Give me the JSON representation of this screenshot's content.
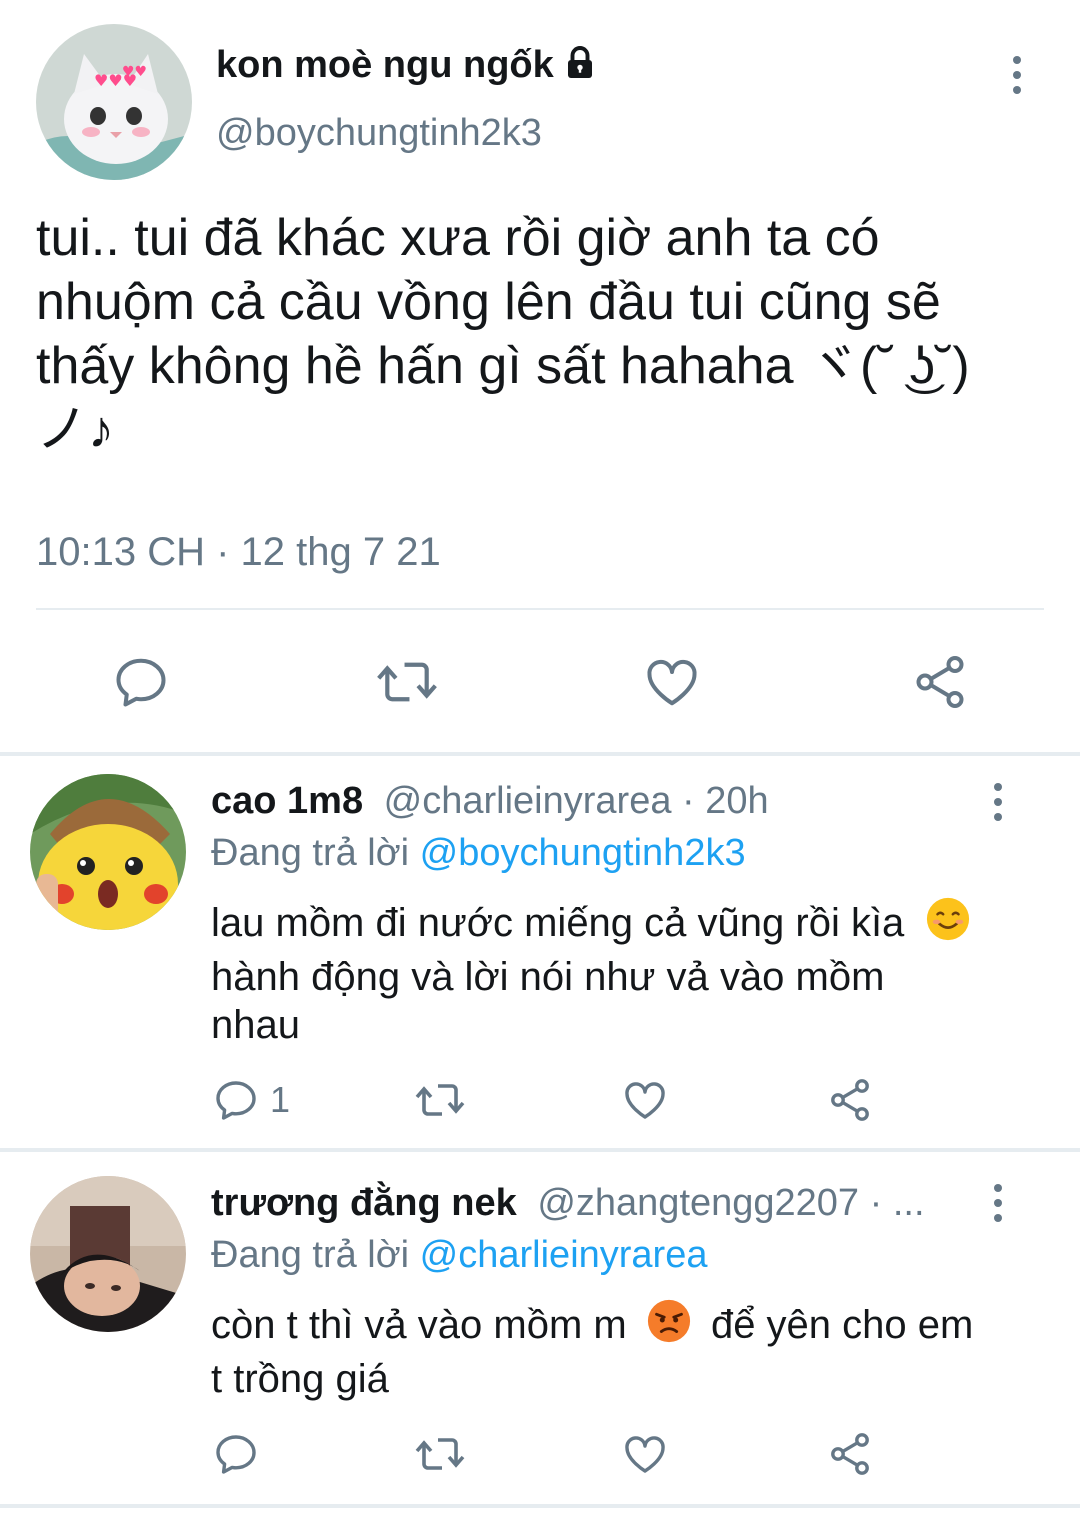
{
  "main_tweet": {
    "display_name": "kon moè ngu ngốk",
    "handle": "@boychungtinh2k3",
    "text_lines": [
      "tui.. tui đã khác xưa rồi giờ anh ta có",
      "nhuộm cả cầu vồng lên đầu tui cũng sẽ",
      "thấy không hề hấn gì sất hahaha ヾ(˘ ͜ʖ˘)",
      "ノ♪"
    ],
    "timestamp": "10:13 CH · 12 thg 7 21",
    "icons": [
      "reply-icon",
      "retweet-icon",
      "like-icon",
      "share-icon",
      "lock-icon",
      "more-icon"
    ]
  },
  "replies": [
    {
      "display_name": "cao 1m8",
      "handle_time": "@charlieinyrarea · 20h",
      "replying_prefix": "Đang trả lời",
      "replying_to": "@boychungtinh2k3",
      "text_lines": [
        "lau mồm đi nước miếng cả vũng rồi kìa",
        "hành động và lời nói như vả vào mồm",
        "nhau"
      ],
      "emoji": "smiling-face-icon",
      "reply_count": "1"
    },
    {
      "display_name": "trương đằng nek",
      "handle_time": "@zhangtengg2207 · ...",
      "replying_prefix": "Đang trả lời",
      "replying_to": "@charlieinyrarea",
      "text_lines": [
        "còn t thì vả vào mồm m",
        "để yên cho em",
        "t trồng giá"
      ],
      "emoji": "angry-face-icon",
      "reply_count": ""
    }
  ],
  "colors": {
    "text": "#14171a",
    "secondary": "#657786",
    "link": "#1da1f2",
    "divider": "#e6ecf0"
  }
}
